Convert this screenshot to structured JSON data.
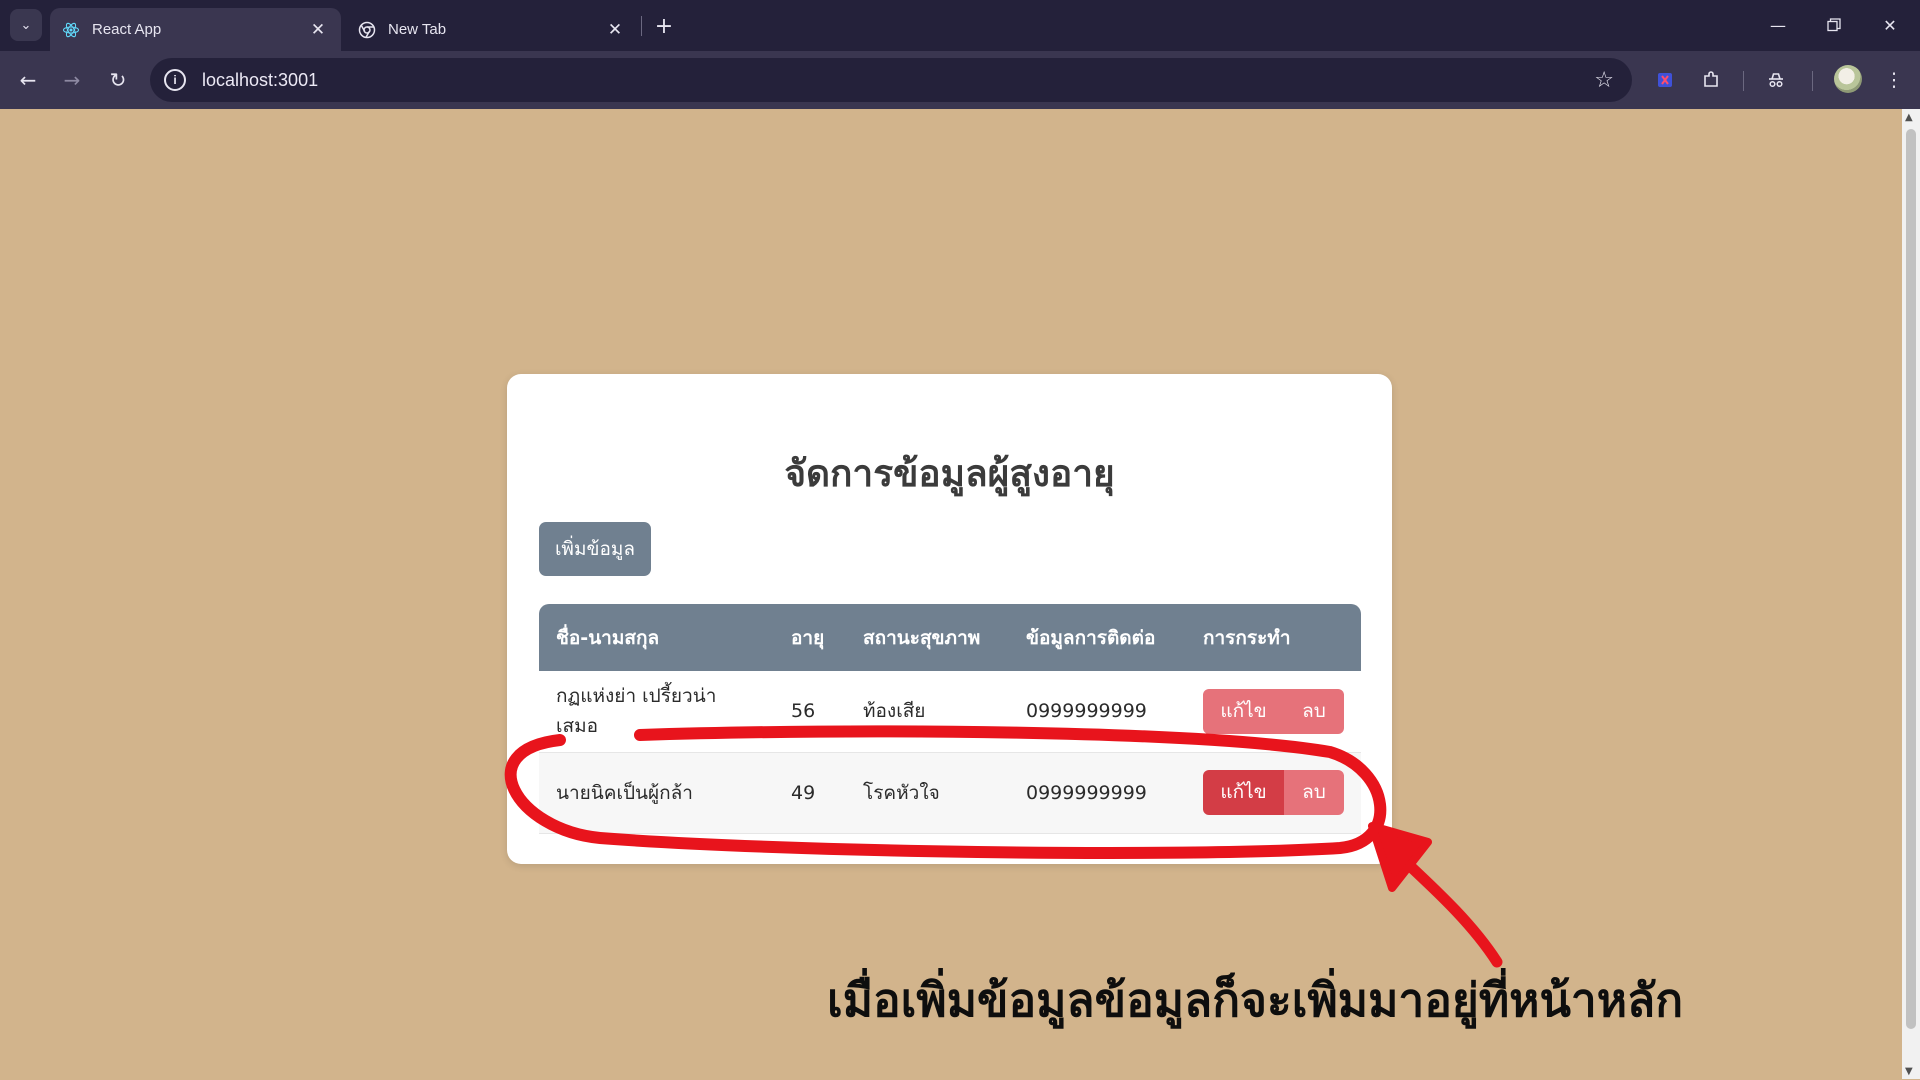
{
  "browser": {
    "tabs": [
      {
        "title": "React App",
        "icon": "react-icon"
      },
      {
        "title": "New Tab",
        "icon": "chrome-icon"
      }
    ],
    "address": "localhost:3001"
  },
  "page": {
    "title": "จัดการข้อมูลผู้สูงอายุ",
    "add_button": "เพิ่มข้อมูล",
    "table": {
      "headers": [
        "ชื่อ-นามสกุล",
        "อายุ",
        "สถานะสุขภาพ",
        "ข้อมูลการติดต่อ",
        "การกระทำ"
      ],
      "rows": [
        {
          "name": "กฏแห่งย่า เปรี้ยวน่าเสมอ",
          "age": "56",
          "health": "ท้องเสีย",
          "contact": "0999999999",
          "edit": "แก้ไข",
          "delete": "ลบ"
        },
        {
          "name": "นายนิคเป็นผู้กล้า",
          "age": "49",
          "health": "โรคหัวใจ",
          "contact": "0999999999",
          "edit": "แก้ไข",
          "delete": "ลบ"
        }
      ]
    }
  },
  "annotation": {
    "caption": "เมื่อเพิ่มข้อมูลข้อมูลก็จะเพิ่มมาอยู่ที่หน้าหลัก",
    "color": "#e8141c"
  },
  "colors": {
    "page_bg": "#d2b48c",
    "header_bg": "#708090",
    "button_bg": "#708090",
    "edit_button": "#e6727a",
    "edit_button_hover": "#d33d46"
  }
}
